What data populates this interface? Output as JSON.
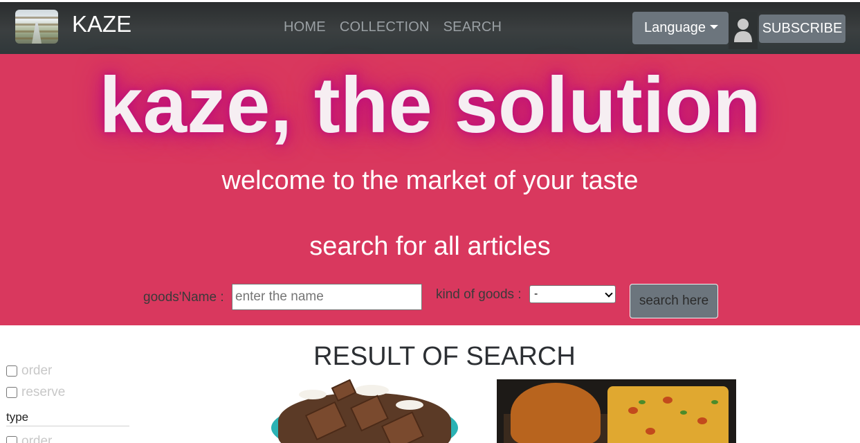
{
  "navbar": {
    "brand": "KAZE",
    "links": [
      "HOME",
      "COLLECTION",
      "SEARCH"
    ],
    "language_label": "Language",
    "subscribe_label": "SUBSCRIBE"
  },
  "hero": {
    "title": "kaze, the solution",
    "subtitle": "welcome to the market of your taste",
    "search_title": "search for all articles",
    "name_label": "goods'Name :",
    "name_placeholder": "enter the name",
    "kind_label": "kind of goods :",
    "kind_selected": "-",
    "search_button": "search here"
  },
  "results": {
    "title": "RESULT OF SEARCH"
  },
  "filters": {
    "items": [
      "order",
      "reserve"
    ],
    "type_label": "type",
    "type_items": [
      "order"
    ]
  },
  "colors": {
    "navbar": "#343a40",
    "hero": "#d9385e",
    "button": "#6c757d",
    "title_glow": "#c0107a"
  }
}
